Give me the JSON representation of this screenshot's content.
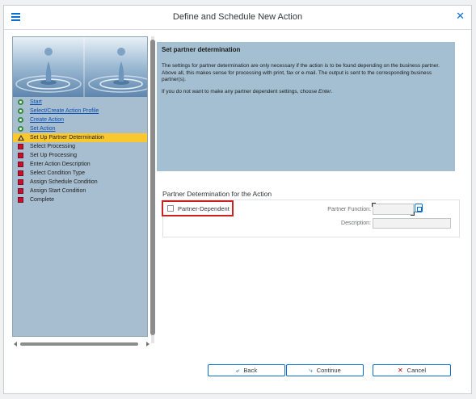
{
  "window": {
    "title": "Define and Schedule New Action"
  },
  "wizard": {
    "steps": [
      {
        "label": "Start",
        "state": "done"
      },
      {
        "label": "Select/Create Action Profile",
        "state": "done"
      },
      {
        "label": "Create Action",
        "state": "done"
      },
      {
        "label": "Set Action",
        "state": "done"
      },
      {
        "label": "Set Up Partner Determination",
        "state": "current"
      },
      {
        "label": "Select Processing",
        "state": "todo"
      },
      {
        "label": "Set Up Processing",
        "state": "todo"
      },
      {
        "label": "Enter Action Description",
        "state": "todo"
      },
      {
        "label": "Select Condition Type",
        "state": "todo"
      },
      {
        "label": "Assign Schedule Condition",
        "state": "todo"
      },
      {
        "label": "Assign Start Condition",
        "state": "todo"
      },
      {
        "label": "Complete",
        "state": "todo"
      }
    ]
  },
  "info": {
    "title": "Set partner determination",
    "body": "The settings for partner determination are only necessary if the action is to be found depending on the business partner. Above all, this makes sense for processing with print, fax or e-mail. The output is sent to the corresponding business partner(s).",
    "note_prefix": "If you do not want to make any partner dependent settings, choose ",
    "note_emphasis": "Enter",
    "note_suffix": "."
  },
  "form": {
    "section_title": "Partner Determination for the Action",
    "partner_dependent_label": "Partner-Dependent",
    "partner_dependent_checked": false,
    "partner_function_label": "Partner Function:",
    "partner_function_value": "",
    "description_label": "Description:",
    "description_value": ""
  },
  "buttons": {
    "back": "Back",
    "continue": "Continue",
    "cancel": "Cancel"
  },
  "colors": {
    "accent": "#0a6ed1",
    "current_step": "#f9c82f",
    "info_bg": "#a3bfd1",
    "highlight": "#cc2222"
  }
}
